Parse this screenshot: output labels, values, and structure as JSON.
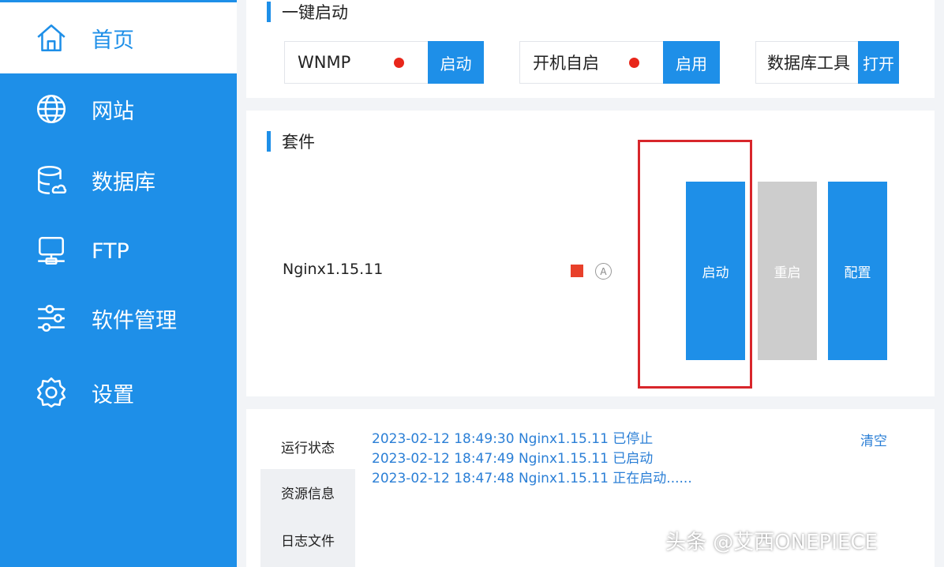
{
  "sidebar": {
    "items": [
      {
        "label": "首页",
        "icon": "home-icon",
        "active": true
      },
      {
        "label": "网站",
        "icon": "globe-icon"
      },
      {
        "label": "数据库",
        "icon": "database-icon"
      },
      {
        "label": "FTP",
        "icon": "ftp-server-icon"
      },
      {
        "label": "软件管理",
        "icon": "sliders-icon"
      },
      {
        "label": "设置",
        "icon": "gear-icon"
      }
    ]
  },
  "quick_start": {
    "title": "一键启动",
    "items": [
      {
        "label": "WNMP",
        "button": "启动",
        "status_color": "#e8261a"
      },
      {
        "label": "开机自启",
        "button": "启用",
        "status_color": "#e8261a"
      },
      {
        "label": "数据库工具",
        "button": "打开"
      }
    ]
  },
  "suite": {
    "title": "套件",
    "name": "Nginx1.15.11",
    "auto_icon_text": "A",
    "status_color": "#e8402a",
    "buttons": {
      "start": "启动",
      "restart": "重启",
      "config": "配置"
    }
  },
  "log": {
    "tabs": [
      "运行状态",
      "资源信息",
      "日志文件"
    ],
    "clear": "清空",
    "lines": [
      "2023-02-12 18:49:30 Nginx1.15.11 已停止",
      "2023-02-12 18:47:49 Nginx1.15.11 已启动",
      "2023-02-12 18:47:48 Nginx1.15.11 正在启动......"
    ]
  },
  "watermark": "头条 @艾西ONEPIECE",
  "colors": {
    "accent": "#1e8fe8",
    "highlight_border": "#d8262b",
    "disabled": "#cdcdcd"
  }
}
